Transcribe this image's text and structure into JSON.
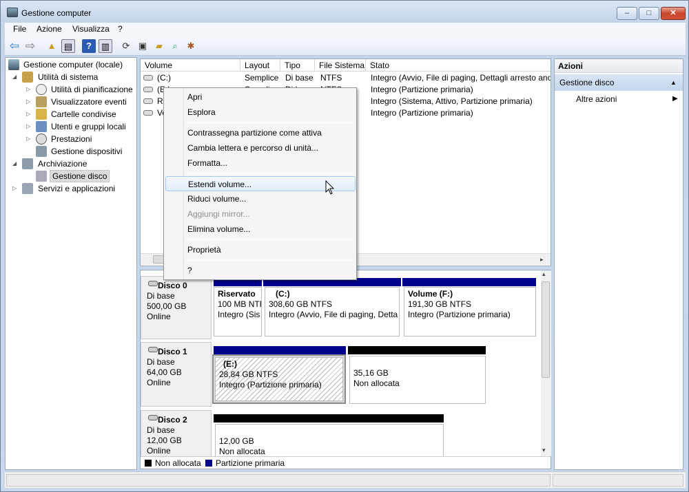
{
  "window": {
    "title": "Gestione computer",
    "buttons": {
      "minimize": "–",
      "maximize": "□",
      "close": "✕"
    }
  },
  "menubar": [
    "File",
    "Azione",
    "Visualizza",
    "?"
  ],
  "toolbar": {
    "icons": [
      "back-icon",
      "forward-icon",
      "folder-up-icon",
      "console-tree-icon",
      "help-icon",
      "details-icon",
      "refresh-icon",
      "properties-icon",
      "open-icon",
      "search-icon",
      "settings-icon"
    ]
  },
  "tree": {
    "root": "Gestione computer (locale)",
    "system": "Utilità di sistema",
    "system_children": [
      "Utilità di pianificazione",
      "Visualizzatore eventi",
      "Cartelle condivise",
      "Utenti e gruppi locali",
      "Prestazioni",
      "Gestione dispositivi"
    ],
    "storage": "Archiviazione",
    "disk_mgmt": "Gestione disco",
    "services": "Servizi e applicazioni"
  },
  "volume_list": {
    "columns": [
      "Volume",
      "Layout",
      "Tipo",
      "File Sistema",
      "Stato"
    ],
    "rows": [
      {
        "volume": "(C:)",
        "layout": "Semplice",
        "tipo": "Di base",
        "fs": "NTFS",
        "stato": "Integro (Avvio, File di paging, Dettagli arresto ano"
      },
      {
        "volume": "(E:)",
        "layout": "Semplice",
        "tipo": "Di base",
        "fs": "NTFS",
        "stato": "Integro (Partizione primaria)"
      },
      {
        "volume": "Ris",
        "layout": "",
        "tipo": "",
        "fs": "",
        "stato": "Integro (Sistema, Attivo, Partizione primaria)"
      },
      {
        "volume": "Vo",
        "layout": "",
        "tipo": "",
        "fs": "",
        "stato": "Integro (Partizione primaria)"
      }
    ]
  },
  "disks": [
    {
      "name": "Disco 0",
      "type": "Di base",
      "size": "500,00 GB",
      "status": "Online",
      "partitions": [
        {
          "label": "Riservato",
          "size": "100 MB NTF",
          "status": "Integro (Sis"
        },
        {
          "label": "(C:)",
          "size": "308,60 GB NTFS",
          "status": "Integro (Avvio, File di paging, Detta"
        },
        {
          "label": "Volume  (F:)",
          "size": "191,30 GB NTFS",
          "status": "Integro (Partizione primaria)"
        }
      ]
    },
    {
      "name": "Disco 1",
      "type": "Di base",
      "size": "64,00 GB",
      "status": "Online",
      "partitions": [
        {
          "label": "(E:)",
          "size": "28,84 GB NTFS",
          "status": "Integro (Partizione primaria)"
        },
        {
          "label": "",
          "size": "35,16 GB",
          "status": "Non allocata"
        }
      ]
    },
    {
      "name": "Disco 2",
      "type": "Di base",
      "size": "12,00 GB",
      "status": "Online",
      "partitions": [
        {
          "label": "",
          "size": "12,00 GB",
          "status": "Non allocata"
        }
      ]
    }
  ],
  "legend": [
    "Non allocata",
    "Partizione primaria"
  ],
  "colors": {
    "unallocated": "#000000",
    "primary": "#00008b",
    "accent": "#c5d7ee"
  },
  "actions": {
    "title": "Azioni",
    "section": "Gestione disco",
    "more": "Altre azioni"
  },
  "context_menu": {
    "items": [
      "Apri",
      "Esplora",
      "Contrassegna partizione come attiva",
      "Cambia lettera e percorso di unità...",
      "Formatta...",
      "Estendi volume...",
      "Riduci volume...",
      "Aggiungi mirror...",
      "Elimina volume...",
      "Proprietà",
      "?"
    ],
    "highlighted": "Estendi volume...",
    "disabled": "Aggiungi mirror..."
  }
}
